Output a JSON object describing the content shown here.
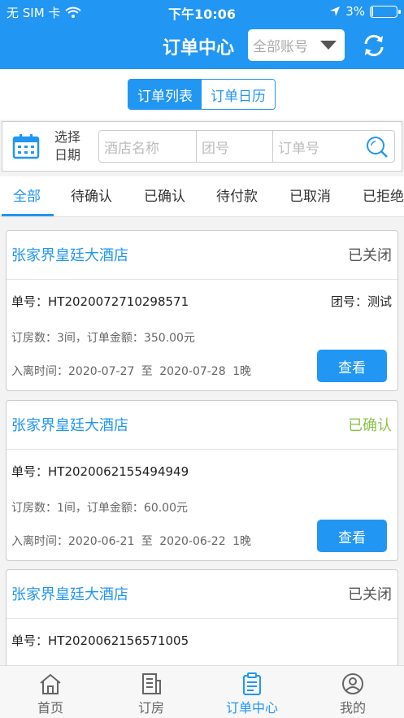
{
  "status_bar": {
    "carrier": "无 SIM 卡",
    "time": "下午10:06",
    "battery": "3%"
  },
  "header": {
    "title": "订单中心",
    "account_select": "全部账号"
  },
  "segment": {
    "options": [
      "订单列表",
      "订单日历"
    ],
    "selected": "订单列表"
  },
  "filter": {
    "date_label_line1": "选择",
    "date_label_line2": "日期",
    "hotel_placeholder": "酒店名称",
    "group_placeholder": "团号",
    "order_placeholder": "订单号"
  },
  "tabs": [
    "全部",
    "待确认",
    "已确认",
    "待付款",
    "已取消",
    "已拒绝"
  ],
  "orders": [
    {
      "hotel": "张家界皇廷大酒店",
      "status": "已关闭",
      "order_no": "单号：HT2020072710298571",
      "group_no": "团号：测试",
      "rooms_amount": "订房数：3间，订单金额：350.00元",
      "stay": "入离时间：2020-07-27 至 2020-07-28  1晚",
      "button": "查看"
    },
    {
      "hotel": "张家界皇廷大酒店",
      "status": "已确认",
      "order_no": "单号：HT2020062155494949",
      "group_no": "",
      "rooms_amount": "订房数：1间，订单金额：60.00元",
      "stay": "入离时间：2020-06-21 至 2020-06-22  1晚",
      "button": "查看"
    },
    {
      "hotel": "张家界皇廷大酒店",
      "status": "已关闭",
      "order_no": "单号：HT2020062156571005",
      "group_no": "",
      "rooms_amount": "",
      "stay": "",
      "button": ""
    }
  ],
  "tabbar": {
    "items": [
      "首页",
      "订房",
      "订单中心",
      "我的"
    ],
    "active": "订单中心"
  },
  "colors": {
    "primary": "#2196f3",
    "confirmed": "#8bc34a"
  }
}
